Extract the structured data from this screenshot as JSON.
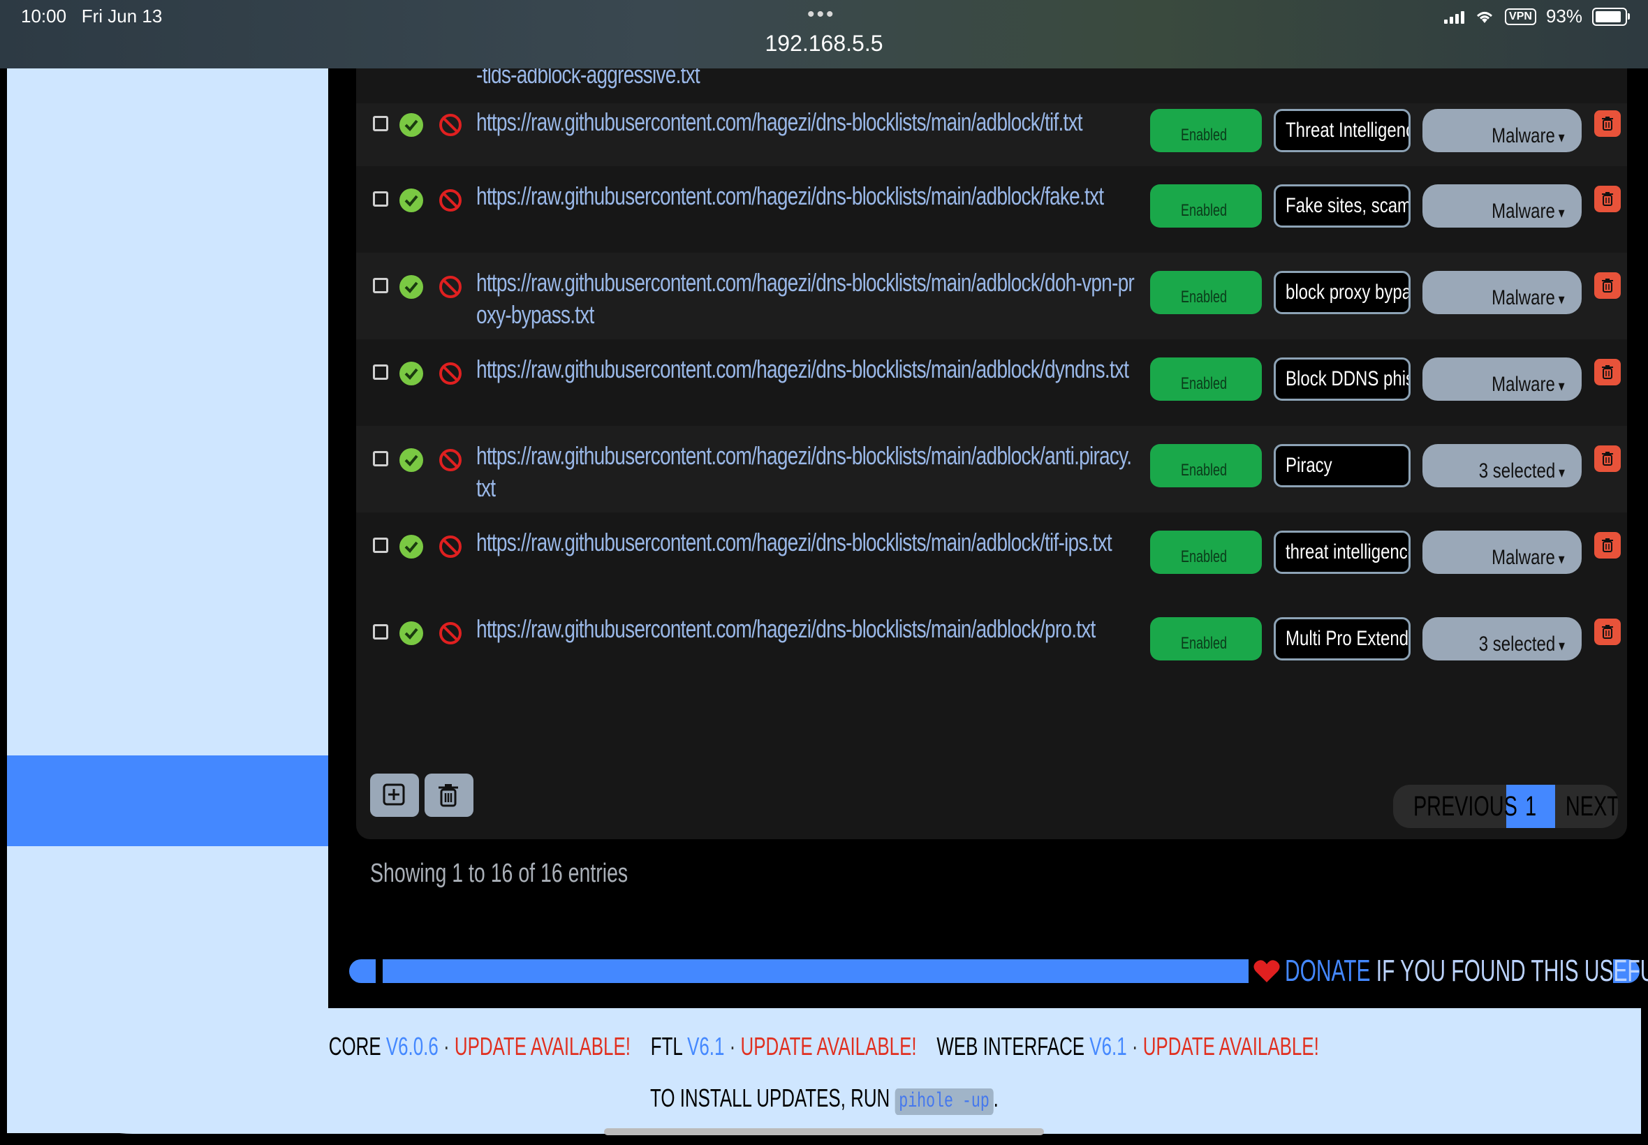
{
  "status_bar": {
    "time": "10:00",
    "date": "Fri Jun 13",
    "url": "192.168.5.5",
    "vpn": "VPN",
    "battery": "93%"
  },
  "top_fragment": "-tlds-adblock-aggressive.txt",
  "rows": [
    {
      "url": "https://raw.githubusercontent.com/hagezi/dns-blocklists/main/adblock/tif.txt",
      "status": "Enabled",
      "comment": "Threat Intelligence",
      "group": "Malware"
    },
    {
      "url": "https://raw.githubusercontent.com/hagezi/dns-blocklists/main/adblock/fake.txt",
      "status": "Enabled",
      "comment": "Fake sites, scam",
      "group": "Malware"
    },
    {
      "url": "https://raw.githubusercontent.com/hagezi/dns-blocklists/main/adblock/doh-vpn-proxy-bypass.txt",
      "status": "Enabled",
      "comment": "block proxy bypass",
      "group": "Malware"
    },
    {
      "url": "https://raw.githubusercontent.com/hagezi/dns-blocklists/main/adblock/dyndns.txt",
      "status": "Enabled",
      "comment": "Block DDNS phishing",
      "group": "Malware"
    },
    {
      "url": "https://raw.githubusercontent.com/hagezi/dns-blocklists/main/adblock/anti.piracy.txt",
      "status": "Enabled",
      "comment": "Piracy",
      "group": "3 selected"
    },
    {
      "url": "https://raw.githubusercontent.com/hagezi/dns-blocklists/main/adblock/tif-ips.txt",
      "status": "Enabled",
      "comment": "threat intelligence",
      "group": "Malware"
    },
    {
      "url": "https://raw.githubusercontent.com/hagezi/dns-blocklists/main/adblock/pro.txt",
      "status": "Enabled",
      "comment": "Multi Pro Extended",
      "group": "3 selected"
    }
  ],
  "pagination": {
    "previous": "PREVIOUS",
    "current": "1",
    "next": "NEXT"
  },
  "table_info": "Showing 1 to 16 of 16 entries",
  "donate": {
    "link": "DONATE",
    "rest": "IF YOU FOUND THIS USEFUL."
  },
  "versions": {
    "core_label": "CORE",
    "core_version": "V6.0.6",
    "ftl_label": "FTL",
    "ftl_version": "V6.1",
    "web_label": "WEB INTERFACE",
    "web_version": "V6.1",
    "update": "UPDATE AVAILABLE!",
    "separator": "·"
  },
  "install": {
    "prefix": "TO INSTALL UPDATES, RUN",
    "command": "pihole -up",
    "suffix": "."
  },
  "colors": {
    "accent": "#4488ff",
    "enabled": "#1aa84a",
    "delete": "#e8533a",
    "frame": "#cfe6ff"
  }
}
